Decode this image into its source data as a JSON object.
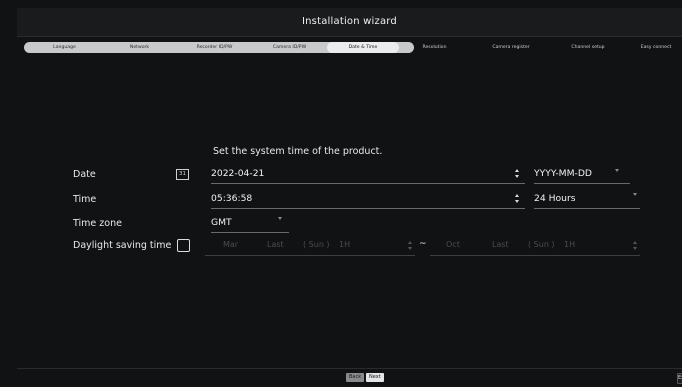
{
  "title": "Installation wizard",
  "steps": [
    {
      "label": "Language",
      "state": "done"
    },
    {
      "label": "Network",
      "state": "done"
    },
    {
      "label": "Recorder ID/PW",
      "state": "done"
    },
    {
      "label": "Camera ID/PW",
      "state": "done"
    },
    {
      "label": "Date & Time",
      "state": "active"
    },
    {
      "label": "Resolution",
      "state": "todo"
    },
    {
      "label": "Camera register",
      "state": "todo"
    },
    {
      "label": "Channel setup",
      "state": "todo"
    },
    {
      "label": "Easy connect",
      "state": "todo"
    }
  ],
  "heading": "Set the system time of the product.",
  "date": {
    "label": "Date",
    "calendar_icon_text": "31",
    "value": "2022-04-21",
    "format": "YYYY-MM-DD"
  },
  "time": {
    "label": "Time",
    "value": "05:36:58",
    "format": "24 Hours"
  },
  "timezone": {
    "label": "Time zone",
    "value": "GMT"
  },
  "dst": {
    "label": "Daylight saving time",
    "start_month": "Mar",
    "start_week": "Last",
    "start_day": "( Sun )",
    "start_hour": "1H",
    "separator": "~",
    "end_month": "Oct",
    "end_week": "Last",
    "end_day": "( Sun )",
    "end_hour": "1H"
  },
  "footer": {
    "back": "Back",
    "next": "Next",
    "exit": "Ex"
  }
}
